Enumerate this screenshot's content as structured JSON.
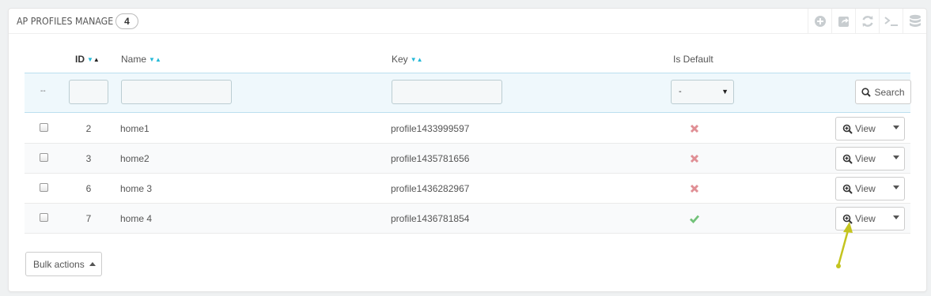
{
  "panel": {
    "title": "AP PROFILES MANAGE",
    "count": "4",
    "toolbar_icons": [
      "add-new-icon",
      "export-icon",
      "refresh-icon",
      "sql-query-icon",
      "database-icon"
    ]
  },
  "columns": {
    "id": "ID",
    "name": "Name",
    "key": "Key",
    "is_default": "Is Default"
  },
  "filters": {
    "bulk_placeholder": "--",
    "default_select_value": "-",
    "search_label": "Search"
  },
  "rows": [
    {
      "id": "2",
      "name": "home1",
      "key": "profile1433999597",
      "is_default": false,
      "action": "View"
    },
    {
      "id": "3",
      "name": "home2",
      "key": "profile1435781656",
      "is_default": false,
      "action": "View"
    },
    {
      "id": "6",
      "name": "home 3",
      "key": "profile1436282967",
      "is_default": false,
      "action": "View"
    },
    {
      "id": "7",
      "name": "home 4",
      "key": "profile1436781854",
      "is_default": true,
      "action": "View"
    }
  ],
  "bulk_actions_label": "Bulk actions",
  "colors": {
    "accent": "#25b9d7",
    "filter_bg": "#eff8fc",
    "status_no": "#e08f95",
    "status_yes": "#72c279",
    "annotation_arrow": "#c4c41f"
  }
}
